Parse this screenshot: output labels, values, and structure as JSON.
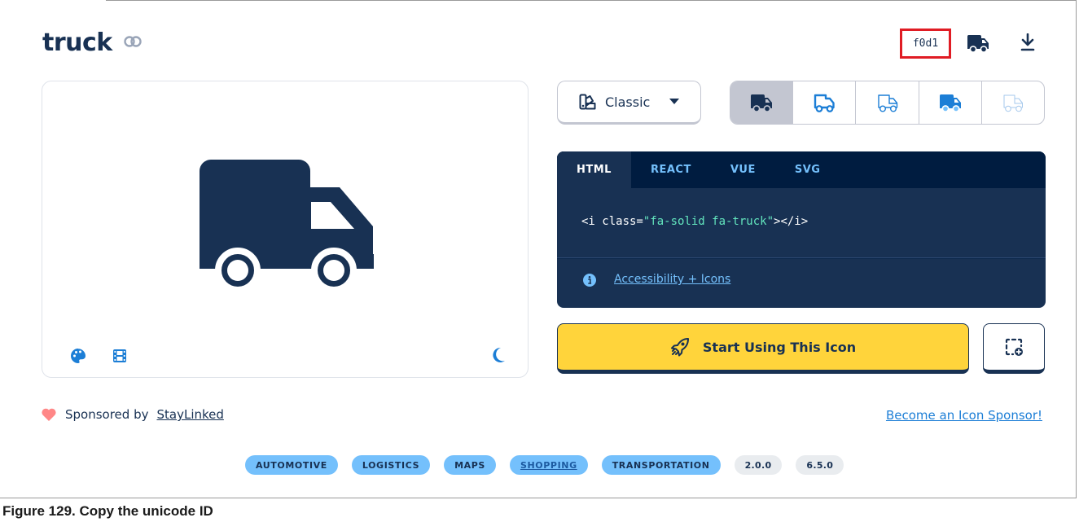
{
  "icon_page": {
    "title": "truck",
    "unicode": "f0d1",
    "style_select": {
      "label": "Classic"
    },
    "code_tabs": [
      "HTML",
      "REACT",
      "VUE",
      "SVG"
    ],
    "code_snippet": {
      "prefix": "<i class=",
      "value": "\"fa-solid fa-truck\"",
      "suffix": "></i>"
    },
    "accessibility_link": "Accessibility + Icons",
    "start_button": "Start Using This Icon",
    "sponsor": {
      "prefix": "Sponsored by",
      "name": "StayLinked"
    },
    "become_sponsor": "Become an Icon Sponsor!",
    "tags": [
      "AUTOMOTIVE",
      "LOGISTICS",
      "MAPS",
      "SHOPPING",
      "TRANSPORTATION"
    ],
    "versions": [
      "2.0.0",
      "6.5.0"
    ]
  },
  "figure_caption": "Figure 129.  Copy the unicode ID",
  "colors": {
    "navy": "#183153",
    "blue": "#1c7ed6",
    "yellow": "#ffd43b",
    "highlight": "#e01c24"
  },
  "icons": [
    "link-icon",
    "truck-icon",
    "download-icon",
    "palette-icon",
    "film-icon",
    "moon-icon",
    "swatchbook-icon",
    "caret-down-icon",
    "circle-info-icon",
    "rocket-icon",
    "add-to-collection-icon",
    "heart-icon"
  ]
}
